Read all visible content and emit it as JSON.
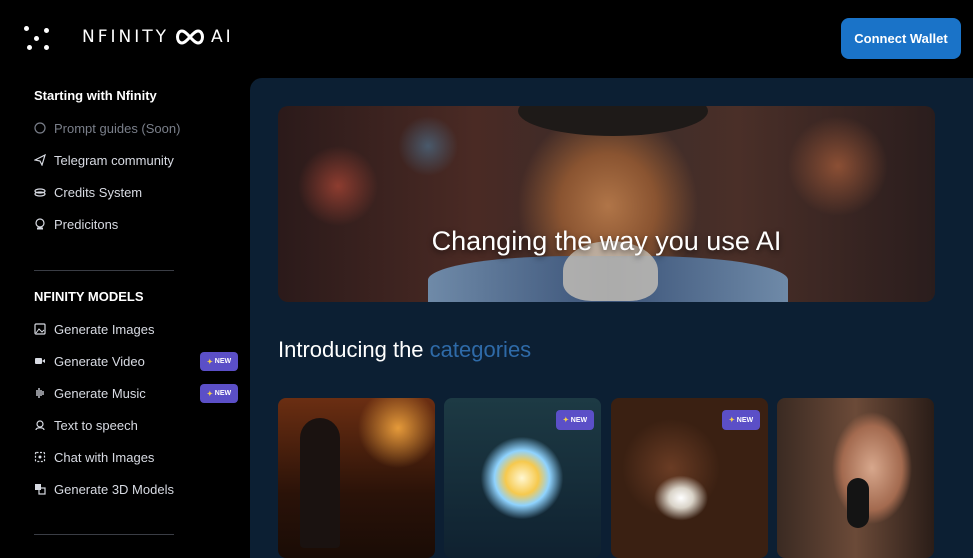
{
  "brand": {
    "name_left": "NFINITY",
    "name_right": "AI"
  },
  "header": {
    "connect_label": "Connect Wallet"
  },
  "sidebar": {
    "section1_title": "Starting with Nfinity",
    "section1_items": [
      {
        "label": "Prompt guides (Soon)",
        "icon": "whatsapp-icon"
      },
      {
        "label": "Telegram community",
        "icon": "telegram-icon"
      },
      {
        "label": "Credits System",
        "icon": "coins-icon"
      },
      {
        "label": "Predicitons",
        "icon": "crystal-ball-icon"
      }
    ],
    "section2_title": "NFINITY MODELS",
    "section2_items": [
      {
        "label": "Generate Images",
        "icon": "image-icon"
      },
      {
        "label": "Generate Video",
        "icon": "video-icon",
        "badge": "NEW"
      },
      {
        "label": "Generate Music",
        "icon": "waveform-icon",
        "badge": "NEW"
      },
      {
        "label": "Text to speech",
        "icon": "speech-icon"
      },
      {
        "label": "Chat with Images",
        "icon": "chat-image-icon"
      },
      {
        "label": "Generate 3D Models",
        "icon": "cube-icon"
      }
    ]
  },
  "hero": {
    "title": "Changing the way you use AI"
  },
  "intro": {
    "prefix": "Introducing the",
    "accent": "categories"
  },
  "cards": [
    {
      "badge": ""
    },
    {
      "badge": "NEW"
    },
    {
      "badge": "NEW"
    },
    {
      "badge": ""
    }
  ],
  "colors": {
    "accent": "#1a73c8",
    "badge": "#5b4fc7",
    "panel": "#0c1f33",
    "intro_accent": "#2e6aa8"
  }
}
